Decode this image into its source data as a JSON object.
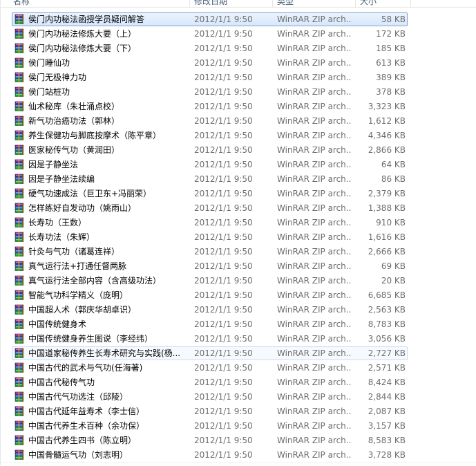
{
  "columns": {
    "name": "名称",
    "date": "修改日期",
    "type": "类型",
    "size": "大小"
  },
  "icon": "winrar-archive-icon",
  "files": [
    {
      "name": "侯门内功秘法函授学员疑问解答",
      "date": "2012/1/1 9:50",
      "type": "WinRAR ZIP arch...",
      "size": "58 KB",
      "state": "selected"
    },
    {
      "name": "侯门内功秘法修炼大要（上）",
      "date": "2012/1/1 9:50",
      "type": "WinRAR ZIP arch...",
      "size": "172 KB",
      "state": ""
    },
    {
      "name": "侯门内功秘法修炼大要（下）",
      "date": "2012/1/1 9:50",
      "type": "WinRAR ZIP arch...",
      "size": "185 KB",
      "state": ""
    },
    {
      "name": "侯门睡仙功",
      "date": "2012/1/1 9:50",
      "type": "WinRAR ZIP arch...",
      "size": "613 KB",
      "state": ""
    },
    {
      "name": "侯门无极神力功",
      "date": "2012/1/1 9:50",
      "type": "WinRAR ZIP arch...",
      "size": "389 KB",
      "state": ""
    },
    {
      "name": "侯门站桩功",
      "date": "2012/1/1 9:50",
      "type": "WinRAR ZIP arch...",
      "size": "378 KB",
      "state": ""
    },
    {
      "name": "仙术秘库（朱壮涌点校）",
      "date": "2012/1/1 9:50",
      "type": "WinRAR ZIP arch...",
      "size": "3,323 KB",
      "state": ""
    },
    {
      "name": "新气功治癌功法（郭林）",
      "date": "2012/1/1 9:50",
      "type": "WinRAR ZIP arch...",
      "size": "1,612 KB",
      "state": ""
    },
    {
      "name": "养生保健功与脚底按摩术（陈平章）",
      "date": "2012/1/1 9:50",
      "type": "WinRAR ZIP arch...",
      "size": "4,346 KB",
      "state": ""
    },
    {
      "name": "医家秘传气功（黄润田）",
      "date": "2012/1/1 9:50",
      "type": "WinRAR ZIP arch...",
      "size": "2,866 KB",
      "state": ""
    },
    {
      "name": "因是子静坐法",
      "date": "2012/1/1 9:50",
      "type": "WinRAR ZIP arch...",
      "size": "64 KB",
      "state": ""
    },
    {
      "name": "因是子静坐法续编",
      "date": "2012/1/1 9:50",
      "type": "WinRAR ZIP arch...",
      "size": "86 KB",
      "state": ""
    },
    {
      "name": "硬气功速成法（巨卫东+冯丽荣）",
      "date": "2012/1/1 9:50",
      "type": "WinRAR ZIP arch...",
      "size": "2,379 KB",
      "state": ""
    },
    {
      "name": "怎样练好自发动功（姚雨山）",
      "date": "2012/1/1 9:50",
      "type": "WinRAR ZIP arch...",
      "size": "1,388 KB",
      "state": ""
    },
    {
      "name": "长寿功（王数）",
      "date": "2012/1/1 9:50",
      "type": "WinRAR ZIP arch...",
      "size": "910 KB",
      "state": ""
    },
    {
      "name": "长寿功法（朱辉）",
      "date": "2012/1/1 9:50",
      "type": "WinRAR ZIP arch...",
      "size": "1,616 KB",
      "state": ""
    },
    {
      "name": "针灸与气功（诸葛连祥）",
      "date": "2012/1/1 9:50",
      "type": "WinRAR ZIP arch...",
      "size": "2,666 KB",
      "state": ""
    },
    {
      "name": "真气运行法+打通任督两脉",
      "date": "2012/1/1 9:50",
      "type": "WinRAR ZIP arch...",
      "size": "69 KB",
      "state": ""
    },
    {
      "name": "真气运行法全部内容（含高级功法）",
      "date": "2012/1/1 9:50",
      "type": "WinRAR ZIP arch...",
      "size": "20 KB",
      "state": ""
    },
    {
      "name": "智能气功科学精义（庞明）",
      "date": "2012/1/1 9:50",
      "type": "WinRAR ZIP arch...",
      "size": "6,685 KB",
      "state": ""
    },
    {
      "name": "中国超人术（郭庆华胡卓识）",
      "date": "2012/1/1 9:50",
      "type": "WinRAR ZIP arch...",
      "size": "2,563 KB",
      "state": ""
    },
    {
      "name": "中国传统健身术",
      "date": "2012/1/1 9:50",
      "type": "WinRAR ZIP arch...",
      "size": "8,783 KB",
      "state": ""
    },
    {
      "name": "中国传统健身养生图说（李经纬）",
      "date": "2012/1/1 9:50",
      "type": "WinRAR ZIP arch...",
      "size": "3,056 KB",
      "state": ""
    },
    {
      "name": "中国道家秘传养生长寿术研究与实践(杨...",
      "date": "2012/1/1 9:50",
      "type": "WinRAR ZIP arch...",
      "size": "2,727 KB",
      "state": "hover"
    },
    {
      "name": "中国古代的武术与气功(任海著)",
      "date": "2012/1/1 9:50",
      "type": "WinRAR ZIP arch...",
      "size": "2,571 KB",
      "state": ""
    },
    {
      "name": "中国古代秘传气功",
      "date": "2012/1/1 9:50",
      "type": "WinRAR ZIP arch...",
      "size": "8,424 KB",
      "state": ""
    },
    {
      "name": "中国古代气功选注（邱陵）",
      "date": "2012/1/1 9:50",
      "type": "WinRAR ZIP arch...",
      "size": "2,844 KB",
      "state": ""
    },
    {
      "name": "中国古代延年益寿术（李士信）",
      "date": "2012/1/1 9:50",
      "type": "WinRAR ZIP arch...",
      "size": "2,087 KB",
      "state": ""
    },
    {
      "name": "中国古代养生术百种（余功保）",
      "date": "2012/1/1 9:50",
      "type": "WinRAR ZIP arch...",
      "size": "3,157 KB",
      "state": ""
    },
    {
      "name": "中国古代养生四书（陈立明）",
      "date": "2012/1/1 9:50",
      "type": "WinRAR ZIP arch...",
      "size": "8,583 KB",
      "state": ""
    },
    {
      "name": "中国骨髓运气功（刘志明）",
      "date": "2012/1/1 9:50",
      "type": "WinRAR ZIP arch...",
      "size": "3,728 KB",
      "state": ""
    }
  ]
}
